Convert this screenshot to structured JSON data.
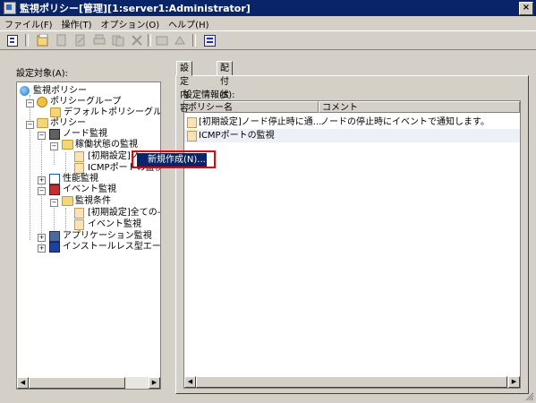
{
  "window": {
    "title": "監視ポリシー[管理][1:server1:Administrator]",
    "close_label": "×"
  },
  "menu": [
    "ファイル(F)",
    "操作(T)",
    "オプション(O)",
    "ヘルプ(H)"
  ],
  "left_panel": {
    "label": "設定対象(A):",
    "tree": [
      {
        "label": "監視ポリシー",
        "icon": "globe-icon"
      },
      {
        "label": "ポリシーグループ",
        "icon": "policy-group-icon"
      },
      {
        "label": "デフォルトポリシーグルー",
        "icon": "default-policy-icon"
      },
      {
        "label": "ポリシー",
        "icon": "folder-icon"
      },
      {
        "label": "ノード監視",
        "icon": "node-monitor-icon"
      },
      {
        "label": "稼働状態の監視",
        "icon": "folder-icon"
      },
      {
        "label": "[初期設定]ノ",
        "icon": "document-icon"
      },
      {
        "label": "ICMPポートの監視",
        "icon": "document-icon"
      },
      {
        "label": "性能監視",
        "icon": "performance-icon"
      },
      {
        "label": "イベント監視",
        "icon": "event-monitor-icon"
      },
      {
        "label": "監視条件",
        "icon": "folder-icon"
      },
      {
        "label": "[初期設定]全ての-",
        "icon": "document-icon"
      },
      {
        "label": "イベント監視",
        "icon": "document-icon"
      },
      {
        "label": "アプリケーション監視",
        "icon": "application-icon"
      },
      {
        "label": "インストールレス型エージ",
        "icon": "agentless-icon"
      }
    ]
  },
  "tabs": [
    "設定内容",
    "配付状況"
  ],
  "right_panel": {
    "label": "設定情報(S):",
    "columns": [
      "ポリシー名",
      "コメント"
    ],
    "rows": [
      {
        "name": "[初期設定]ノード停止時に通...",
        "comment": "ノードの停止時にイベントで通知します。"
      },
      {
        "name": "ICMPポートの監視",
        "comment": ""
      }
    ]
  },
  "context_menu": {
    "item": "新規作成(N)..."
  },
  "colors": {
    "titlebar": "#0a246a",
    "highlight_border": "#e8000b",
    "face": "#d4d0c8"
  }
}
